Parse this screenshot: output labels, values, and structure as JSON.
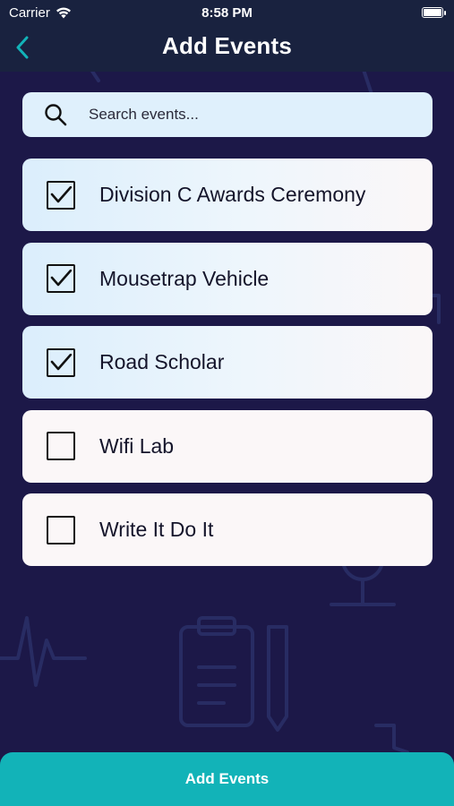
{
  "status_bar": {
    "carrier": "Carrier",
    "time": "8:58 PM"
  },
  "nav": {
    "title": "Add Events",
    "back_icon": "chevron-left-icon"
  },
  "search": {
    "placeholder": "Search events...",
    "value": ""
  },
  "events": [
    {
      "label": "Division C Awards Ceremony",
      "checked": true
    },
    {
      "label": "Mousetrap Vehicle",
      "checked": true
    },
    {
      "label": "Road Scholar",
      "checked": true
    },
    {
      "label": "Wifi Lab",
      "checked": false
    },
    {
      "label": "Write It Do It",
      "checked": false
    }
  ],
  "footer": {
    "add_button_label": "Add Events"
  },
  "colors": {
    "background": "#1c1848",
    "nav_background": "#19223f",
    "accent": "#12b3b8",
    "search_background": "#dff0fc",
    "card_background": "#fbf7f8"
  }
}
